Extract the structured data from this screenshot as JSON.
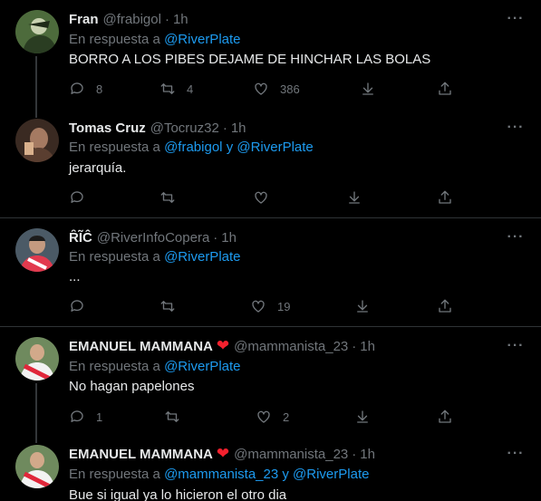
{
  "tweets": [
    {
      "name": "Fran",
      "verified_heart": false,
      "handle": "@frabigol",
      "time": "1h",
      "reply_prefix": "En respuesta a",
      "mentions": [
        "@RiverPlate"
      ],
      "mention_joiner": "",
      "text": "BORRO A LOS PIBES DEJAME DE HINCHAR LAS BOLAS",
      "replies": "8",
      "retweets": "4",
      "likes": "386"
    },
    {
      "name": "Tomas Cruz",
      "verified_heart": false,
      "handle": "@Tocruz32",
      "time": "1h",
      "reply_prefix": "En respuesta a",
      "mentions": [
        "@frabigol",
        "@RiverPlate"
      ],
      "mention_joiner": "y",
      "text": "jerarquía.",
      "replies": "",
      "retweets": "",
      "likes": ""
    },
    {
      "name": "ȒĨĈ",
      "verified_heart": false,
      "handle": "@RiverInfoCopera",
      "time": "1h",
      "reply_prefix": "En respuesta a",
      "mentions": [
        "@RiverPlate"
      ],
      "mention_joiner": "",
      "text": "...",
      "replies": "",
      "retweets": "",
      "likes": "19"
    },
    {
      "name": "EMANUEL MAMMANA",
      "verified_heart": true,
      "handle": "@mammanista_23",
      "time": "1h",
      "reply_prefix": "En respuesta a",
      "mentions": [
        "@RiverPlate"
      ],
      "mention_joiner": "",
      "text": "No hagan papelones",
      "replies": "1",
      "retweets": "",
      "likes": "2"
    },
    {
      "name": "EMANUEL MAMMANA",
      "verified_heart": true,
      "handle": "@mammanista_23",
      "time": "1h",
      "reply_prefix": "En respuesta a",
      "mentions": [
        "@mammanista_23",
        "@RiverPlate"
      ],
      "mention_joiner": "y",
      "text": "Bue si igual ya lo hicieron el otro dia",
      "replies": "",
      "retweets": "",
      "likes": ""
    }
  ],
  "ui": {
    "dot": "·",
    "more": "···",
    "heart_badge": "❤"
  },
  "icons": {
    "reply": "reply-icon",
    "retweet": "retweet-icon",
    "like": "like-icon",
    "bookmark": "download-icon",
    "share": "share-icon"
  },
  "colors": {
    "background": "#000000",
    "text": "#e7e9ea",
    "muted": "#71767b",
    "link": "#1d9bf0",
    "divider": "#2f3336",
    "heart": "#f4212e"
  }
}
